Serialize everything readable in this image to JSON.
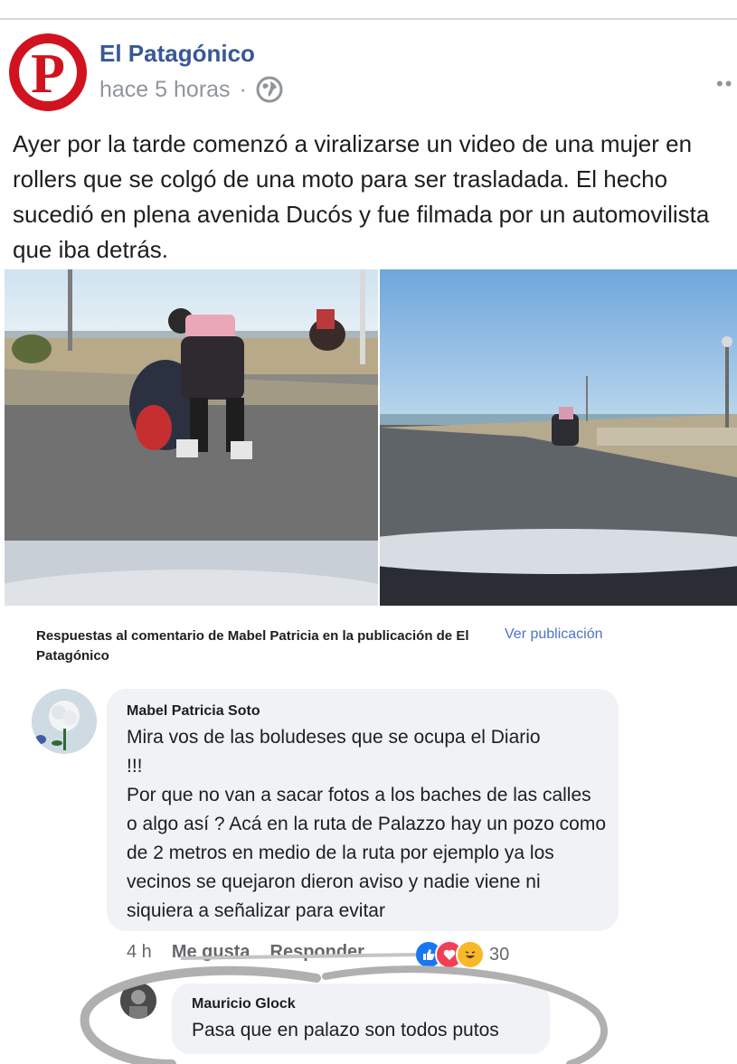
{
  "post": {
    "page_name": "El Patagónico",
    "avatar_letter": "P",
    "time": "hace 5 horas",
    "separator": "·",
    "text": "Ayer por la tarde comenzó a viralizarse un video de una mujer en rollers que se colgó de una moto para ser trasladada. El hecho sucedió en plena avenida Ducós y fue filmada por un automovilista que iba detrás.",
    "more_icon": "ellipsis-icon",
    "privacy_icon": "globe-icon"
  },
  "reply_thread": {
    "header": "Respuestas al comentario de Mabel Patricia en la publicación de El Patagónico",
    "view_post": "Ver publicación"
  },
  "comment1": {
    "author": "Mabel Patricia Soto",
    "line1": "Mira vos de las boludeses que se ocupa el Diario",
    "line2": "!!!",
    "paragraph": "Por que no van a sacar fotos a los baches de las calles o algo así ? Acá en la ruta de Palazzo hay un pozo como de 2 metros en medio de la ruta por ejemplo ya los vecinos se quejaron dieron aviso y nadie viene ni siquiera a señalizar para evitar",
    "time": "4 h",
    "like": "Me gusta",
    "reply": "Responder",
    "reaction_count": "30",
    "reaction_icons": [
      "like-icon",
      "love-icon",
      "haha-icon"
    ]
  },
  "comment2": {
    "author": "Mauricio Glock",
    "text": "Pasa que en palazo son todos putos"
  },
  "colors": {
    "link_blue": "#385898",
    "brand_red": "#d0131f",
    "bubble_bg": "#f0f2f5",
    "meta_gray": "#90949c"
  }
}
